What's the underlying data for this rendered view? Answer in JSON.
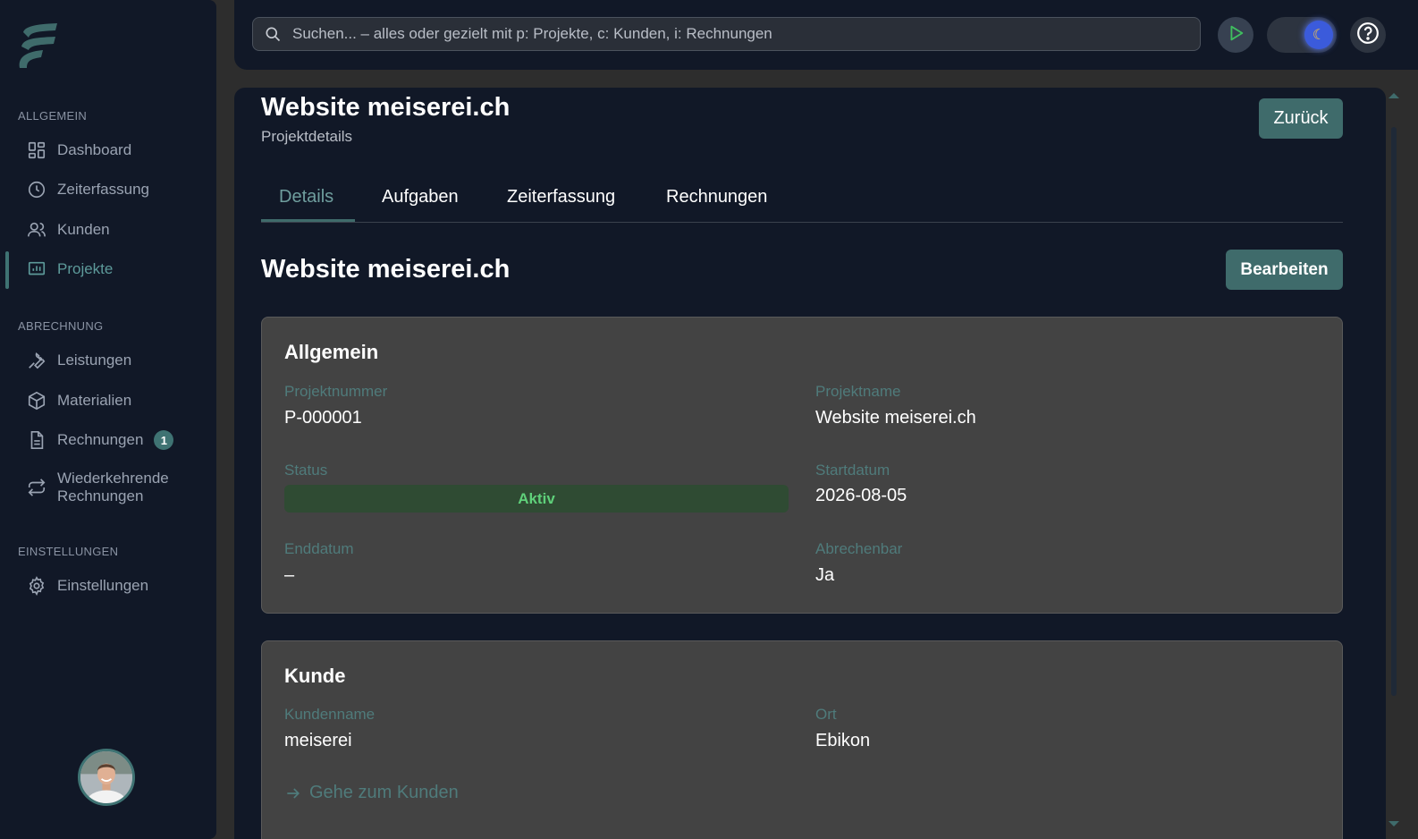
{
  "sidebar": {
    "sections": [
      {
        "title": "ALLGEMEIN"
      },
      {
        "title": "ABRECHNUNG"
      },
      {
        "title": "EINSTELLUNGEN"
      }
    ],
    "items": [
      {
        "label": "Dashboard",
        "icon": "dashboard-grid-icon"
      },
      {
        "label": "Zeiterfassung",
        "icon": "clock-icon"
      },
      {
        "label": "Kunden",
        "icon": "users-icon"
      },
      {
        "label": "Projekte",
        "icon": "presentation-chart-icon",
        "active": true
      },
      {
        "label": "Leistungen",
        "icon": "wrench-icon"
      },
      {
        "label": "Materialien",
        "icon": "package-icon"
      },
      {
        "label": "Rechnungen",
        "icon": "document-icon",
        "badge": "1"
      },
      {
        "label_line1": "Wiederkehrende",
        "label_line2": "Rechnungen",
        "icon": "repeat-icon"
      },
      {
        "label": "Einstellungen",
        "icon": "gear-icon"
      }
    ]
  },
  "topbar": {
    "search_placeholder": "Suchen... – alles oder gezielt mit p: Projekte, c: Kunden, i: Rechnungen"
  },
  "page": {
    "title": "Website meiserei.ch",
    "subtitle": "Projektdetails",
    "back_label": "Zurück",
    "tabs": [
      {
        "label": "Details",
        "active": true
      },
      {
        "label": "Aufgaben"
      },
      {
        "label": "Zeiterfassung"
      },
      {
        "label": "Rechnungen"
      }
    ],
    "section_title": "Website meiserei.ch",
    "edit_label": "Bearbeiten"
  },
  "general_card": {
    "title": "Allgemein",
    "project_number_label": "Projektnummer",
    "project_number": "P-000001",
    "project_name_label": "Projektname",
    "project_name": "Website meiserei.ch",
    "status_label": "Status",
    "status": "Aktiv",
    "start_label": "Startdatum",
    "start": "2026-08-05",
    "end_label": "Enddatum",
    "end": "–",
    "billable_label": "Abrechenbar",
    "billable": "Ja"
  },
  "customer_card": {
    "title": "Kunde",
    "name_label": "Kundenname",
    "name": "meiserei",
    "city_label": "Ort",
    "city": "Ebikon",
    "link_label": "Gehe zum Kunden"
  },
  "colors": {
    "accent": "#3f6b6b",
    "sidebar_bg": "#111827",
    "status_green": "#5fd07a"
  }
}
